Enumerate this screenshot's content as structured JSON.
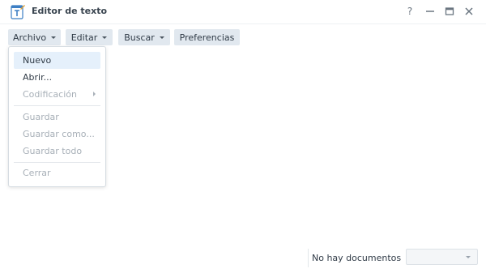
{
  "window": {
    "title": "Editor de texto",
    "icons": {
      "app": "text-editor-icon",
      "help": "help-icon",
      "minimize": "minimize-icon",
      "maximize": "maximize-icon",
      "close": "close-icon"
    },
    "help_glyph": "?"
  },
  "toolbar": {
    "archivo_label": "Archivo",
    "editar_label": "Editar",
    "buscar_label": "Buscar",
    "preferencias_label": "Preferencias"
  },
  "menu": {
    "items": [
      {
        "label": "Nuevo",
        "enabled": true,
        "highlighted": true
      },
      {
        "label": "Abrir...",
        "enabled": true
      },
      {
        "label": "Codificación",
        "enabled": false,
        "submenu": true
      },
      {
        "label": "Guardar",
        "enabled": false
      },
      {
        "label": "Guardar como...",
        "enabled": false
      },
      {
        "label": "Guardar todo",
        "enabled": false
      },
      {
        "label": "Cerrar",
        "enabled": false
      }
    ]
  },
  "status": {
    "documents_text": "No hay documentos",
    "document_select_value": ""
  },
  "colors": {
    "toolbar_button_bg": "#e1e8ef",
    "menu_highlight": "#e5f0fb",
    "disabled_text": "#a8b0b8"
  }
}
